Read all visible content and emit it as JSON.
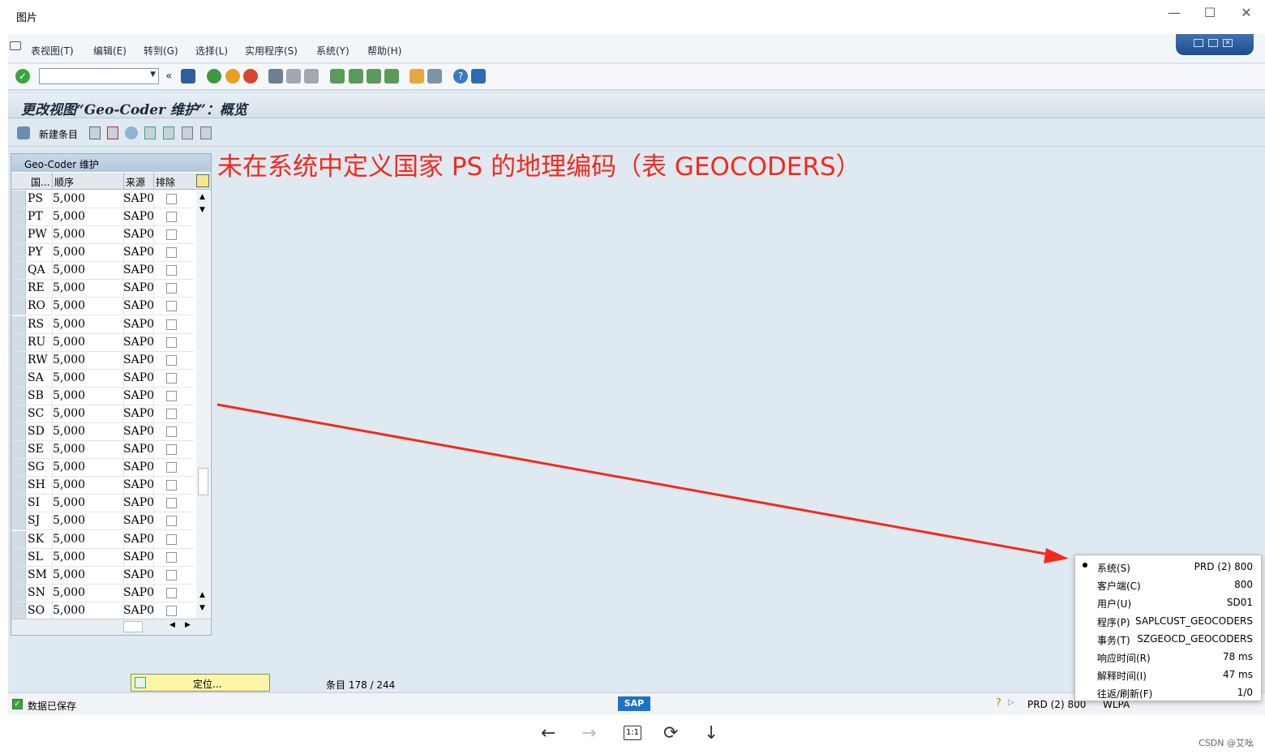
{
  "viewer": {
    "title": "图片",
    "controls": [
      "—",
      "☐",
      "✕"
    ],
    "watermark": "CSDN @艾吆"
  },
  "menu": [
    "表视图(T)",
    "编辑(E)",
    "转到(G)",
    "选择(L)",
    "实用程序(S)",
    "系统(Y)",
    "帮助(H)"
  ],
  "screen_title": "更改视图“Geo-Coder 维护”：概览",
  "app_toolbar": {
    "new_entries": "新建条目"
  },
  "table": {
    "title": "Geo-Coder 维护",
    "columns": [
      "国...",
      "顺序",
      "来源",
      "排除"
    ],
    "rows": [
      {
        "country": "PS",
        "order": "5,000",
        "source": "SAP0"
      },
      {
        "country": "PT",
        "order": "5,000",
        "source": "SAP0"
      },
      {
        "country": "PW",
        "order": "5,000",
        "source": "SAP0"
      },
      {
        "country": "PY",
        "order": "5,000",
        "source": "SAP0"
      },
      {
        "country": "QA",
        "order": "5,000",
        "source": "SAP0"
      },
      {
        "country": "RE",
        "order": "5,000",
        "source": "SAP0"
      },
      {
        "country": "RO",
        "order": "5,000",
        "source": "SAP0"
      },
      {
        "country": "RS",
        "order": "5,000",
        "source": "SAP0"
      },
      {
        "country": "RU",
        "order": "5,000",
        "source": "SAP0"
      },
      {
        "country": "RW",
        "order": "5,000",
        "source": "SAP0"
      },
      {
        "country": "SA",
        "order": "5,000",
        "source": "SAP0"
      },
      {
        "country": "SB",
        "order": "5,000",
        "source": "SAP0"
      },
      {
        "country": "SC",
        "order": "5,000",
        "source": "SAP0"
      },
      {
        "country": "SD",
        "order": "5,000",
        "source": "SAP0"
      },
      {
        "country": "SE",
        "order": "5,000",
        "source": "SAP0"
      },
      {
        "country": "SG",
        "order": "5,000",
        "source": "SAP0"
      },
      {
        "country": "SH",
        "order": "5,000",
        "source": "SAP0"
      },
      {
        "country": "SI",
        "order": "5,000",
        "source": "SAP0"
      },
      {
        "country": "SJ",
        "order": "5,000",
        "source": "SAP0"
      },
      {
        "country": "SK",
        "order": "5,000",
        "source": "SAP0"
      },
      {
        "country": "SL",
        "order": "5,000",
        "source": "SAP0"
      },
      {
        "country": "SM",
        "order": "5,000",
        "source": "SAP0"
      },
      {
        "country": "SN",
        "order": "5,000",
        "source": "SAP0"
      },
      {
        "country": "SO",
        "order": "5,000",
        "source": "SAP0"
      }
    ]
  },
  "position_button": "定位...",
  "entry_counter": "条目 178 / 244",
  "status": {
    "message": "数据已保存",
    "system": "PRD (2) 800",
    "server": "WLPA"
  },
  "annotation": "未在系统中定义国家 PS 的地理编码（表 GEOCODERS）",
  "sysinfo": [
    {
      "label": "系统(S)",
      "value": "PRD (2) 800"
    },
    {
      "label": "客户端(C)",
      "value": "800"
    },
    {
      "label": "用户(U)",
      "value": "SD01"
    },
    {
      "label": "程序(P)",
      "value": "SAPLCUST_GEOCODERS"
    },
    {
      "label": "事务(T)",
      "value": "SZGEOCD_GEOCODERS"
    },
    {
      "label": "响应时间(R)",
      "value": "78 ms"
    },
    {
      "label": "解释时间(I)",
      "value": "47 ms"
    },
    {
      "label": "往返/刷新(F)",
      "value": "1/0"
    }
  ],
  "viewer_bottom": {
    "zoom_label": "1:1"
  },
  "colors": {
    "annotation": "#f5291b",
    "sap_bg": "#dfe9f1",
    "position_button": "#fdf5a8"
  }
}
